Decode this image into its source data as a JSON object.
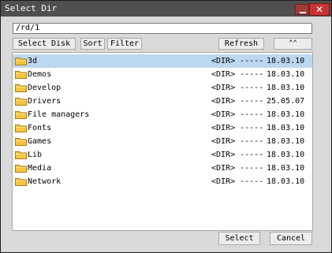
{
  "window": {
    "title": "Select Dir",
    "close_label": "✕"
  },
  "path": {
    "value": "/rd/1"
  },
  "toolbar": {
    "select_disk": "Select Disk",
    "sort": "Sort",
    "filter": "Filter",
    "refresh": "Refresh",
    "collapse": "⌃⌃"
  },
  "files": [
    {
      "name": "3d",
      "size": "<DIR> -----",
      "date": "18.03.10",
      "selected": true
    },
    {
      "name": "Demos",
      "size": "<DIR> -----",
      "date": "18.03.10"
    },
    {
      "name": "Develop",
      "size": "<DIR> -----",
      "date": "18.03.10"
    },
    {
      "name": "Drivers",
      "size": "<DIR> -----",
      "date": "25.05.07"
    },
    {
      "name": "File managers",
      "size": "<DIR> -----",
      "date": "18.03.10"
    },
    {
      "name": "Fonts",
      "size": "<DIR> -----",
      "date": "18.03.10"
    },
    {
      "name": "Games",
      "size": "<DIR> -----",
      "date": "18.03.10"
    },
    {
      "name": "Lib",
      "size": "<DIR> -----",
      "date": "18.03.10"
    },
    {
      "name": "Media",
      "size": "<DIR> -----",
      "date": "18.03.10"
    },
    {
      "name": "Network",
      "size": "<DIR> -----",
      "date": "18.03.10"
    }
  ],
  "actions": {
    "select": "Select",
    "cancel": "Cancel"
  },
  "colors": {
    "selection": "#bcd7f0",
    "titlebar": "#4f4f4f",
    "close": "#c83434",
    "folder": "#f5c542"
  }
}
